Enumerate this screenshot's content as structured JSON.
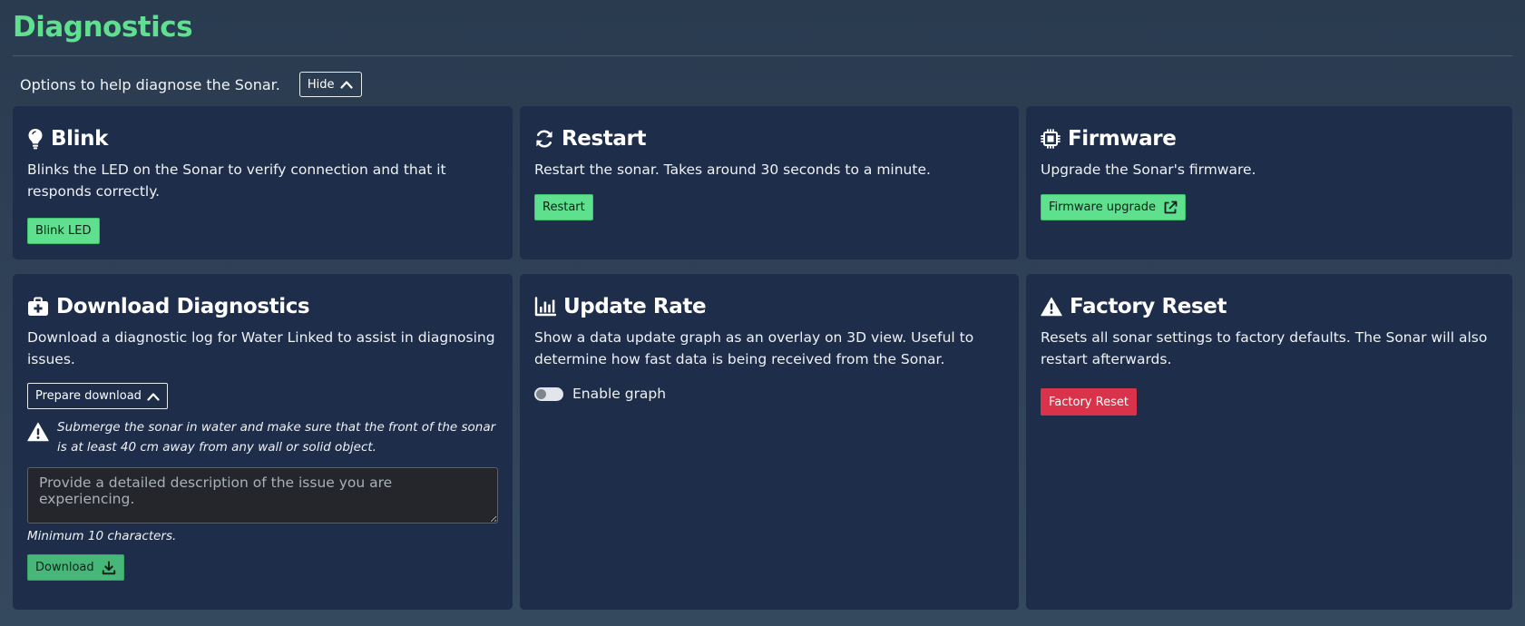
{
  "page": {
    "title": "Diagnostics",
    "intro": "Options to help diagnose the Sonar.",
    "hide_label": "Hide"
  },
  "cards": {
    "blink": {
      "title": "Blink",
      "icon": "lightbulb-icon",
      "description": "Blinks the LED on the Sonar to verify connection and that it responds correctly.",
      "button_label": "Blink LED"
    },
    "restart": {
      "title": "Restart",
      "icon": "refresh-icon",
      "description": "Restart the sonar. Takes around 30 seconds to a minute.",
      "button_label": "Restart"
    },
    "firmware": {
      "title": "Firmware",
      "icon": "chip-icon",
      "description": "Upgrade the Sonar's firmware.",
      "button_label": "Firmware upgrade"
    },
    "download": {
      "title": "Download Diagnostics",
      "icon": "medkit-icon",
      "description": "Download a diagnostic log for Water Linked to assist in diagnosing issues.",
      "prepare_label": "Prepare download",
      "warning": "Submerge the sonar in water and make sure that the front of the sonar is at least 40 cm away from any wall or solid object.",
      "textarea_value": "",
      "textarea_placeholder": "Provide a detailed description of the issue you are experiencing.",
      "hint": "Minimum 10 characters.",
      "button_label": "Download"
    },
    "update_rate": {
      "title": "Update Rate",
      "icon": "bar-chart-icon",
      "description": "Show a data update graph as an overlay on 3D view. Useful to determine how fast data is being received from the Sonar.",
      "toggle_label": "Enable graph",
      "toggle_on": false
    },
    "factory_reset": {
      "title": "Factory Reset",
      "icon": "warning-icon",
      "description": "Resets all sonar settings to factory defaults. The Sonar will also restart afterwards.",
      "button_label": "Factory Reset"
    }
  },
  "colors": {
    "accent_green": "#5ee08f",
    "card_bg": "#1d2d4a",
    "danger_red": "#d8334a"
  }
}
